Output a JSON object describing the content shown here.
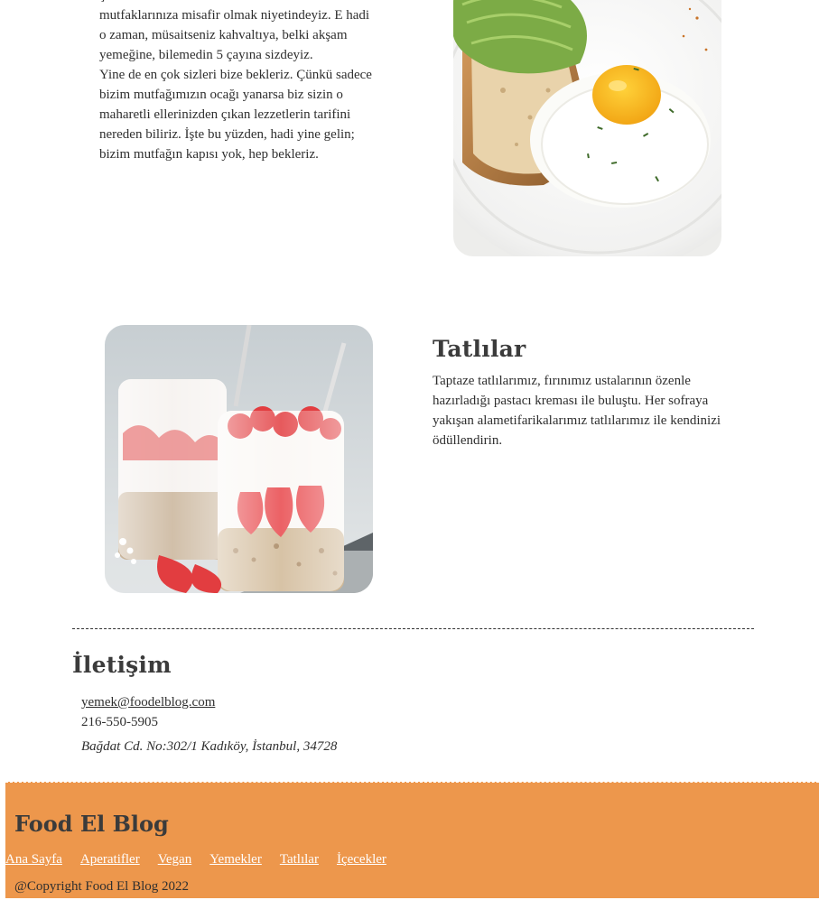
{
  "intro": {
    "lines": [
      "ç",
      "mutfaklarınıza misafir olmak niyetindeyiz. E hadi",
      "o zaman, müsaitseniz kahvaltıya, belki akşam",
      "yemeğine, bilemedin 5 çayına sizdeyiz.",
      "Yine de en çok sizleri bize bekleriz. Çünkü sadece",
      "bizim mutfağımızın ocağı yanarsa biz sizin o",
      "maharetli ellerinizden çıkan lezzetlerin tarifini",
      "nereden biliriz. İşte bu yüzden, hadi yine gelin;",
      "bizim mutfağın kapısı yok, hep bekleriz."
    ]
  },
  "desserts": {
    "title": "Tatlılar",
    "text": "Taptaze tatlılarımız, fırınımız ustalarının özenle hazırladığı pastacı kreması ile buluştu. Her sofraya yakışan alametifarikalarımız tatlılarımız ile kendinizi ödüllendirin."
  },
  "contact": {
    "title": "İletişim",
    "email": "yemek@foodelblog.com",
    "phone": "216-550-5905",
    "address": "Bağdat Cd. No:302/1 Kadıköy, İstanbul, 34728"
  },
  "footer": {
    "title": "Food El Blog",
    "nav": [
      "Ana Sayfa",
      "Aperatifler",
      "Vegan",
      "Yemekler",
      "Tatlılar",
      "İçecekler"
    ],
    "copyright": "@Copyright Food El Blog 2022"
  },
  "colors": {
    "footer_background": "#ed974c",
    "footer_link": "#ffffff",
    "body_text": "#2f2f2f"
  },
  "icons": {
    "breakfast_photo": "avocado-toast-with-fried-egg",
    "dessert_photo": "strawberry-yogurt-jars"
  }
}
